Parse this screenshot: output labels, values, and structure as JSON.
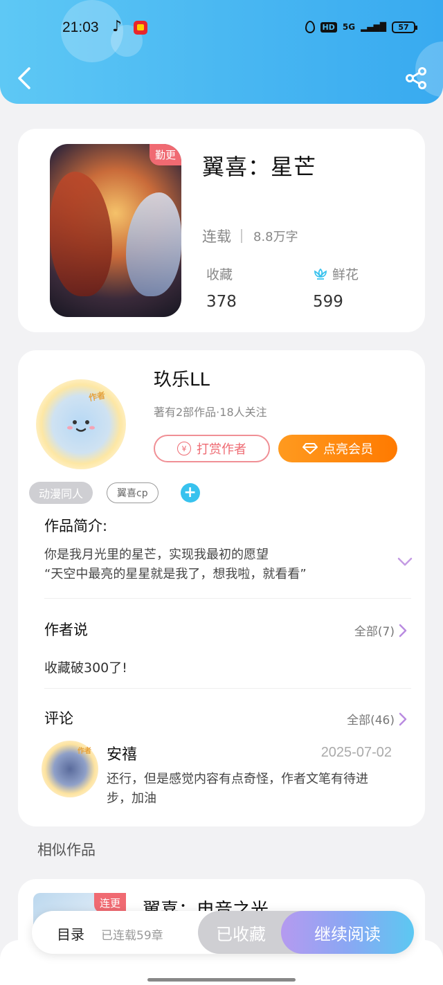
{
  "status_bar": {
    "time": "21:03",
    "network": "HD",
    "signal": "5G",
    "battery": "57"
  },
  "colors": {
    "header_gradient": [
      "#5ec8f5",
      "#38aaf0"
    ],
    "accent_orange": "#ff8a00",
    "accent_pink": "#ee6a72",
    "accent_blue": "#38c2ee"
  },
  "book": {
    "update_tag": "勤更",
    "title": "翼喜：星芒",
    "status": "连载",
    "word_count": "8.8万字",
    "favorites_label": "收藏",
    "favorites_value": "378",
    "flowers_label": "鲜花",
    "flowers_value": "599"
  },
  "author": {
    "avatar_badge": "作者",
    "name": "玖乐LL",
    "meta": "著有2部作品·18人关注",
    "tip_button": "打赏作者",
    "vip_button": "点亮会员",
    "tags": [
      "动漫同人",
      "翼喜cp"
    ]
  },
  "intro": {
    "title": "作品简介:",
    "line1": "你是我月光里的星芒，实现我最初的愿望",
    "line2": "“天空中最亮的星星就是我了，想我啦，就看看”"
  },
  "author_say": {
    "title": "作者说",
    "more": "全部(7)",
    "text": "收藏破300了!"
  },
  "comments": {
    "title": "评论",
    "more": "全部(46)",
    "items": [
      {
        "badge": "作者",
        "name": "安禧",
        "date": "2025-07-02",
        "text": "还行，但是感觉内容有点奇怪，作者文笔有待进步，加油"
      }
    ]
  },
  "similar": {
    "title": "相似作品",
    "items": [
      {
        "tag": "连更",
        "title": "翼喜：电音之光"
      }
    ]
  },
  "bottom_bar": {
    "toc": "目录",
    "chapters": "已连载59章",
    "favorited": "已收藏",
    "continue": "继续阅读"
  }
}
